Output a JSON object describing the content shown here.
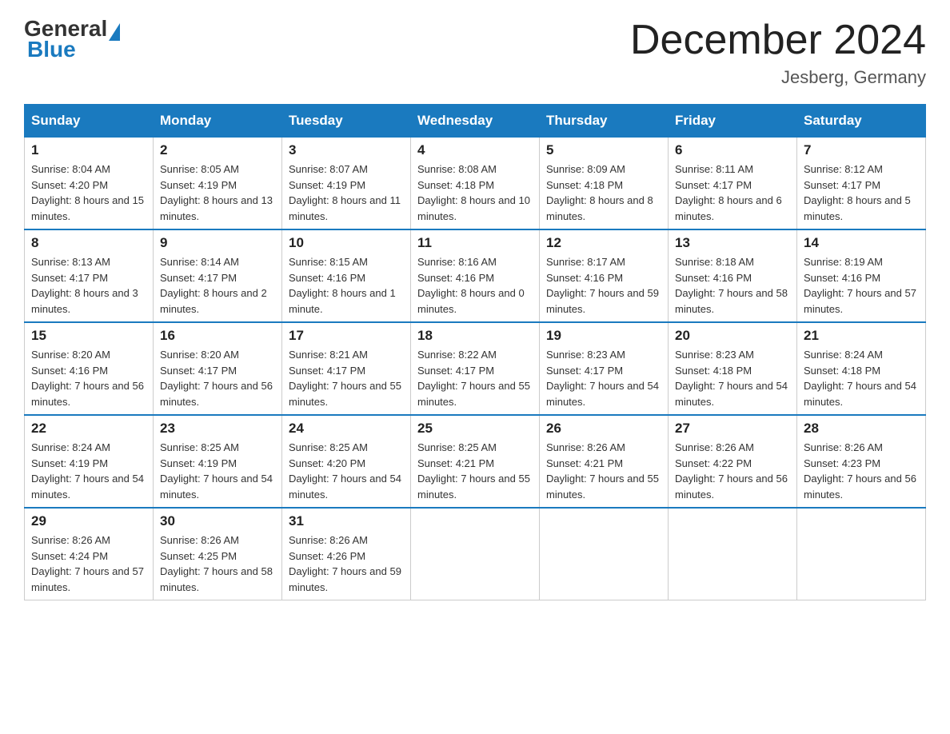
{
  "header": {
    "logo_general": "General",
    "logo_blue": "Blue",
    "month_title": "December 2024",
    "location": "Jesberg, Germany"
  },
  "weekdays": [
    "Sunday",
    "Monday",
    "Tuesday",
    "Wednesday",
    "Thursday",
    "Friday",
    "Saturday"
  ],
  "weeks": [
    [
      {
        "day": "1",
        "sunrise": "8:04 AM",
        "sunset": "4:20 PM",
        "daylight": "8 hours and 15 minutes."
      },
      {
        "day": "2",
        "sunrise": "8:05 AM",
        "sunset": "4:19 PM",
        "daylight": "8 hours and 13 minutes."
      },
      {
        "day": "3",
        "sunrise": "8:07 AM",
        "sunset": "4:19 PM",
        "daylight": "8 hours and 11 minutes."
      },
      {
        "day": "4",
        "sunrise": "8:08 AM",
        "sunset": "4:18 PM",
        "daylight": "8 hours and 10 minutes."
      },
      {
        "day": "5",
        "sunrise": "8:09 AM",
        "sunset": "4:18 PM",
        "daylight": "8 hours and 8 minutes."
      },
      {
        "day": "6",
        "sunrise": "8:11 AM",
        "sunset": "4:17 PM",
        "daylight": "8 hours and 6 minutes."
      },
      {
        "day": "7",
        "sunrise": "8:12 AM",
        "sunset": "4:17 PM",
        "daylight": "8 hours and 5 minutes."
      }
    ],
    [
      {
        "day": "8",
        "sunrise": "8:13 AM",
        "sunset": "4:17 PM",
        "daylight": "8 hours and 3 minutes."
      },
      {
        "day": "9",
        "sunrise": "8:14 AM",
        "sunset": "4:17 PM",
        "daylight": "8 hours and 2 minutes."
      },
      {
        "day": "10",
        "sunrise": "8:15 AM",
        "sunset": "4:16 PM",
        "daylight": "8 hours and 1 minute."
      },
      {
        "day": "11",
        "sunrise": "8:16 AM",
        "sunset": "4:16 PM",
        "daylight": "8 hours and 0 minutes."
      },
      {
        "day": "12",
        "sunrise": "8:17 AM",
        "sunset": "4:16 PM",
        "daylight": "7 hours and 59 minutes."
      },
      {
        "day": "13",
        "sunrise": "8:18 AM",
        "sunset": "4:16 PM",
        "daylight": "7 hours and 58 minutes."
      },
      {
        "day": "14",
        "sunrise": "8:19 AM",
        "sunset": "4:16 PM",
        "daylight": "7 hours and 57 minutes."
      }
    ],
    [
      {
        "day": "15",
        "sunrise": "8:20 AM",
        "sunset": "4:16 PM",
        "daylight": "7 hours and 56 minutes."
      },
      {
        "day": "16",
        "sunrise": "8:20 AM",
        "sunset": "4:17 PM",
        "daylight": "7 hours and 56 minutes."
      },
      {
        "day": "17",
        "sunrise": "8:21 AM",
        "sunset": "4:17 PM",
        "daylight": "7 hours and 55 minutes."
      },
      {
        "day": "18",
        "sunrise": "8:22 AM",
        "sunset": "4:17 PM",
        "daylight": "7 hours and 55 minutes."
      },
      {
        "day": "19",
        "sunrise": "8:23 AM",
        "sunset": "4:17 PM",
        "daylight": "7 hours and 54 minutes."
      },
      {
        "day": "20",
        "sunrise": "8:23 AM",
        "sunset": "4:18 PM",
        "daylight": "7 hours and 54 minutes."
      },
      {
        "day": "21",
        "sunrise": "8:24 AM",
        "sunset": "4:18 PM",
        "daylight": "7 hours and 54 minutes."
      }
    ],
    [
      {
        "day": "22",
        "sunrise": "8:24 AM",
        "sunset": "4:19 PM",
        "daylight": "7 hours and 54 minutes."
      },
      {
        "day": "23",
        "sunrise": "8:25 AM",
        "sunset": "4:19 PM",
        "daylight": "7 hours and 54 minutes."
      },
      {
        "day": "24",
        "sunrise": "8:25 AM",
        "sunset": "4:20 PM",
        "daylight": "7 hours and 54 minutes."
      },
      {
        "day": "25",
        "sunrise": "8:25 AM",
        "sunset": "4:21 PM",
        "daylight": "7 hours and 55 minutes."
      },
      {
        "day": "26",
        "sunrise": "8:26 AM",
        "sunset": "4:21 PM",
        "daylight": "7 hours and 55 minutes."
      },
      {
        "day": "27",
        "sunrise": "8:26 AM",
        "sunset": "4:22 PM",
        "daylight": "7 hours and 56 minutes."
      },
      {
        "day": "28",
        "sunrise": "8:26 AM",
        "sunset": "4:23 PM",
        "daylight": "7 hours and 56 minutes."
      }
    ],
    [
      {
        "day": "29",
        "sunrise": "8:26 AM",
        "sunset": "4:24 PM",
        "daylight": "7 hours and 57 minutes."
      },
      {
        "day": "30",
        "sunrise": "8:26 AM",
        "sunset": "4:25 PM",
        "daylight": "7 hours and 58 minutes."
      },
      {
        "day": "31",
        "sunrise": "8:26 AM",
        "sunset": "4:26 PM",
        "daylight": "7 hours and 59 minutes."
      },
      null,
      null,
      null,
      null
    ]
  ],
  "labels": {
    "sunrise_prefix": "Sunrise: ",
    "sunset_prefix": "Sunset: ",
    "daylight_prefix": "Daylight: "
  }
}
